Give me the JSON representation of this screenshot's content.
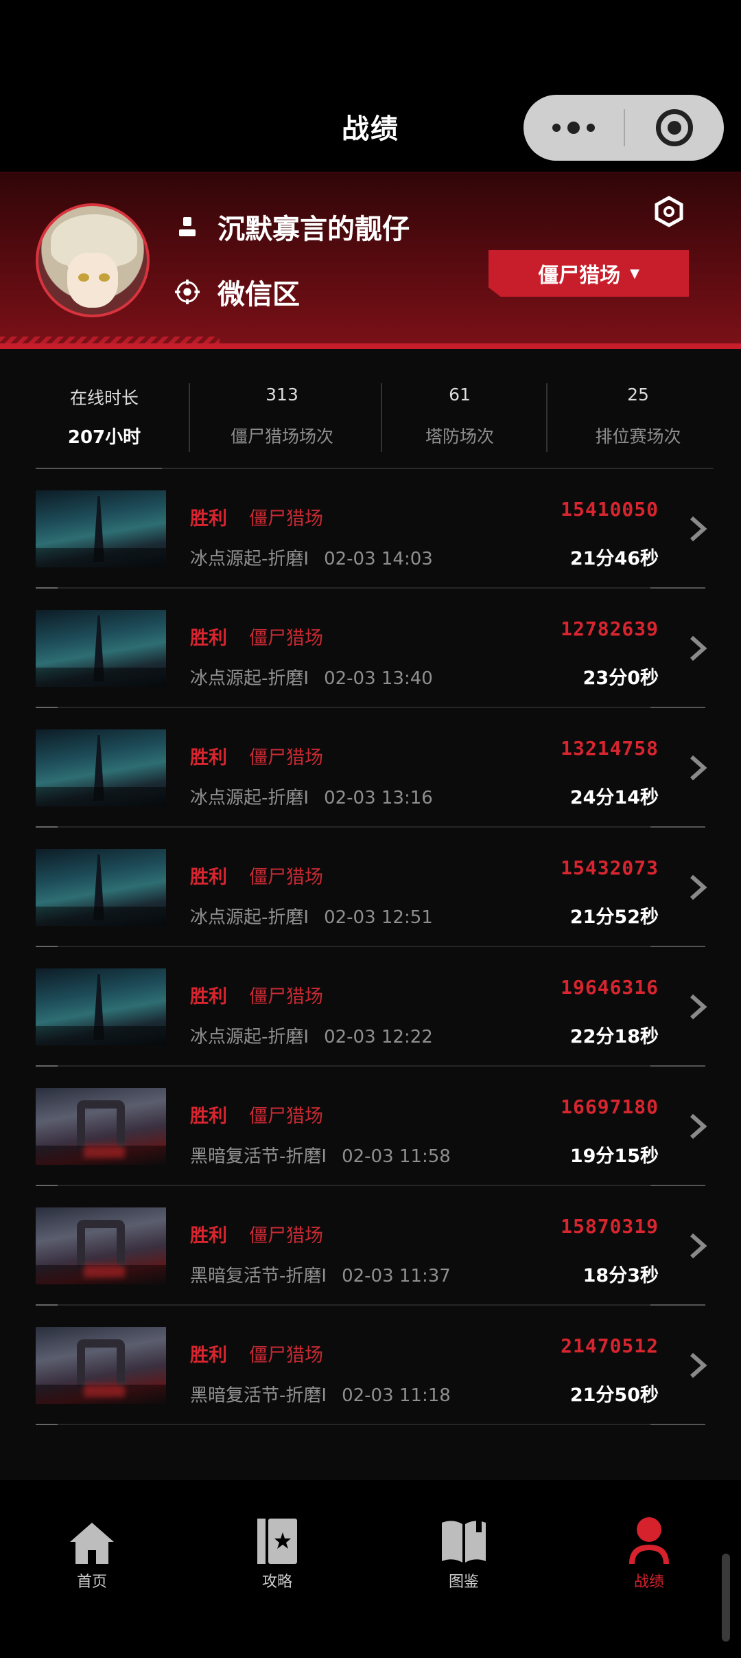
{
  "nav": {
    "title": "战绩"
  },
  "profile": {
    "player_name": "沉默寡言的靓仔",
    "zone": "微信区",
    "mode_selector": "僵尸猎场"
  },
  "stats": [
    {
      "top": "在线时长",
      "bottom": "207小时"
    },
    {
      "top": "313",
      "bottom": "僵尸猎场场次"
    },
    {
      "top": "61",
      "bottom": "塔防场次"
    },
    {
      "top": "25",
      "bottom": "排位赛场次"
    }
  ],
  "records": [
    {
      "result": "胜利",
      "mode": "僵尸猎场",
      "map": "冰点源起-折磨I",
      "time": "02-03 14:03",
      "score": "15410050",
      "duration": "21分46秒",
      "thumb": "ice"
    },
    {
      "result": "胜利",
      "mode": "僵尸猎场",
      "map": "冰点源起-折磨I",
      "time": "02-03 13:40",
      "score": "12782639",
      "duration": "23分0秒",
      "thumb": "ice"
    },
    {
      "result": "胜利",
      "mode": "僵尸猎场",
      "map": "冰点源起-折磨I",
      "time": "02-03 13:16",
      "score": "13214758",
      "duration": "24分14秒",
      "thumb": "ice"
    },
    {
      "result": "胜利",
      "mode": "僵尸猎场",
      "map": "冰点源起-折磨I",
      "time": "02-03 12:51",
      "score": "15432073",
      "duration": "21分52秒",
      "thumb": "ice"
    },
    {
      "result": "胜利",
      "mode": "僵尸猎场",
      "map": "冰点源起-折磨I",
      "time": "02-03 12:22",
      "score": "19646316",
      "duration": "22分18秒",
      "thumb": "ice"
    },
    {
      "result": "胜利",
      "mode": "僵尸猎场",
      "map": "黑暗复活节-折磨I",
      "time": "02-03 11:58",
      "score": "16697180",
      "duration": "19分15秒",
      "thumb": "dark"
    },
    {
      "result": "胜利",
      "mode": "僵尸猎场",
      "map": "黑暗复活节-折磨I",
      "time": "02-03 11:37",
      "score": "15870319",
      "duration": "18分3秒",
      "thumb": "dark"
    },
    {
      "result": "胜利",
      "mode": "僵尸猎场",
      "map": "黑暗复活节-折磨I",
      "time": "02-03 11:18",
      "score": "21470512",
      "duration": "21分50秒",
      "thumb": "dark"
    }
  ],
  "tabs": [
    {
      "label": "首页",
      "icon": "home-icon"
    },
    {
      "label": "攻略",
      "icon": "guide-book-icon"
    },
    {
      "label": "图鉴",
      "icon": "open-book-icon"
    },
    {
      "label": "战绩",
      "icon": "profile-icon",
      "active": true
    }
  ],
  "colors": {
    "accent": "#c81e2b",
    "background": "#0b0b0b",
    "muted_text": "#8f8f8f"
  }
}
